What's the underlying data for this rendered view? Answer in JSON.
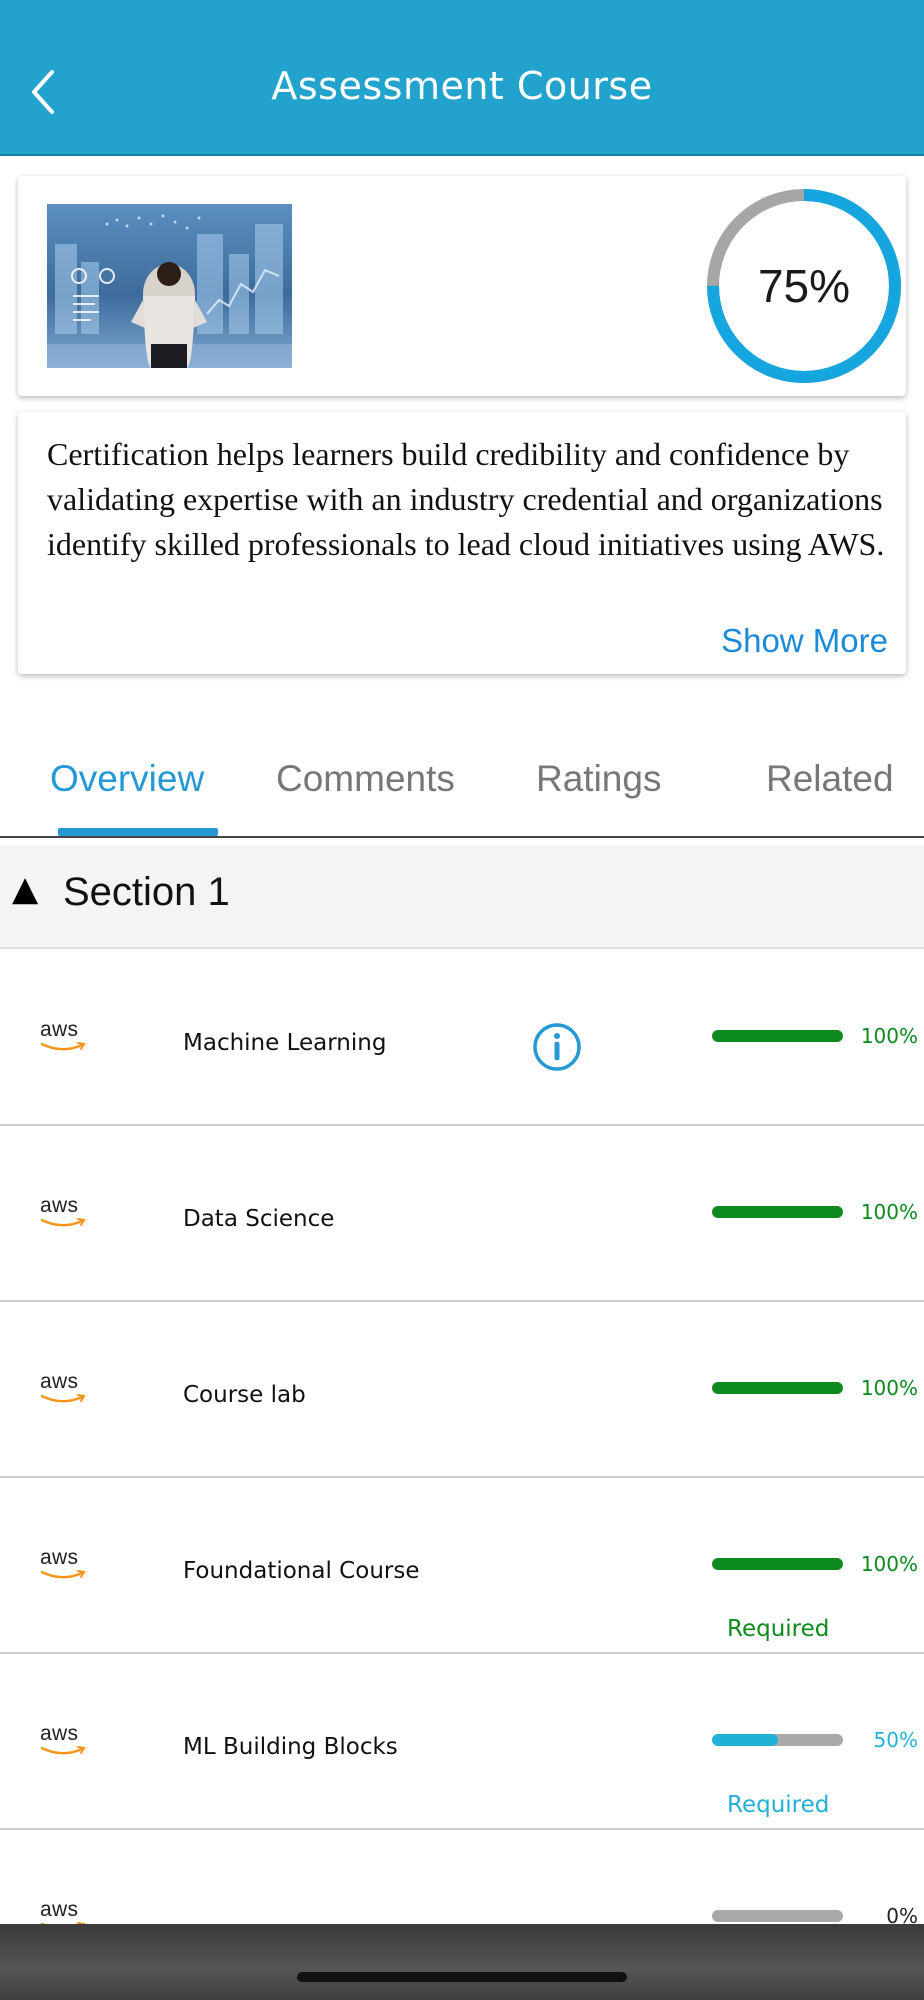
{
  "header": {
    "title": "Assessment Course"
  },
  "course": {
    "progress_label": "75%",
    "progress_value": 0.75
  },
  "description": {
    "text": "Certification helps learners build credibility and confidence by validating expertise with an industry credential and organizations identify skilled professionals to lead cloud initiatives using AWS.",
    "show_more": "Show More"
  },
  "tabs": [
    {
      "label": "Overview",
      "active": true
    },
    {
      "label": "Comments",
      "active": false
    },
    {
      "label": "Ratings",
      "active": false
    },
    {
      "label": "Related",
      "active": false
    }
  ],
  "section": {
    "arrow": "▲",
    "title": "Section 1"
  },
  "items": [
    {
      "logo": "aws",
      "title": "Machine Learning",
      "progress": 1.0,
      "percent_label": "100%",
      "status": "complete",
      "has_info": true,
      "required_label": ""
    },
    {
      "logo": "aws",
      "title": "Data Science",
      "progress": 1.0,
      "percent_label": "100%",
      "status": "complete",
      "has_info": false,
      "required_label": ""
    },
    {
      "logo": "aws",
      "title": "Course lab",
      "progress": 1.0,
      "percent_label": "100%",
      "status": "complete",
      "has_info": false,
      "required_label": ""
    },
    {
      "logo": "aws",
      "title": "Foundational Course",
      "progress": 1.0,
      "percent_label": "100%",
      "status": "complete",
      "has_info": false,
      "required_label": "Required"
    },
    {
      "logo": "aws",
      "title": "ML Building Blocks",
      "progress": 0.5,
      "percent_label": "50%",
      "status": "in-progress",
      "has_info": false,
      "required_label": "Required"
    },
    {
      "logo": "aws",
      "title": "",
      "progress": 0.0,
      "percent_label": "0%",
      "status": "not-started",
      "has_info": false,
      "required_label": ""
    }
  ],
  "colors": {
    "header": "#22a3ce",
    "accent": "#2499d6",
    "complete": "#0c8a1e",
    "in_progress": "#21b1d6",
    "track": "#a9a9a9",
    "ring_progress": "#16a6df",
    "ring_track": "#a6a6a6",
    "aws_smile": "#f3961c"
  },
  "icons": {
    "back": "chevron-left-icon",
    "info": "info-circle-icon"
  }
}
